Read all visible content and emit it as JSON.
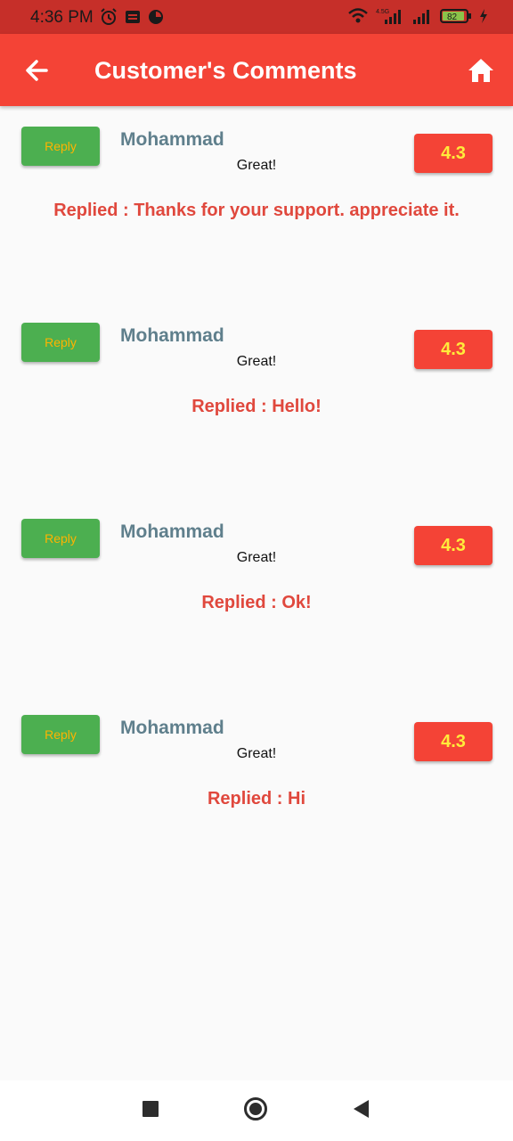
{
  "status_bar": {
    "time": "4:36 PM",
    "network_label": "4.5G",
    "battery": "82"
  },
  "app_bar": {
    "title": "Customer's Comments"
  },
  "comments": [
    {
      "reply_label": "Reply",
      "name": "Mohammad",
      "text": "Great!",
      "rating": "4.3",
      "reply": "Replied : Thanks for your support. appreciate it."
    },
    {
      "reply_label": "Reply",
      "name": "Mohammad",
      "text": "Great!",
      "rating": "4.3",
      "reply": "Replied : Hello!"
    },
    {
      "reply_label": "Reply",
      "name": "Mohammad",
      "text": "Great!",
      "rating": "4.3",
      "reply": "Replied : Ok!"
    },
    {
      "reply_label": "Reply",
      "name": "Mohammad",
      "text": "Great!",
      "rating": "4.3",
      "reply": "Replied : Hi"
    }
  ],
  "colors": {
    "app_bar": "#f44336",
    "status_bar": "#c62f29",
    "reply_button": "#4caf50",
    "reply_button_text": "#ffb300",
    "rating_badge": "#f44336",
    "rating_text": "#ffeb3b",
    "commenter_name": "#5f7f8c",
    "reply_text": "#e0483d"
  },
  "icons": {
    "back": "arrow-back-icon",
    "home": "home-icon",
    "nav_recents": "square-icon",
    "nav_home": "circle-icon",
    "nav_back": "triangle-back-icon"
  }
}
